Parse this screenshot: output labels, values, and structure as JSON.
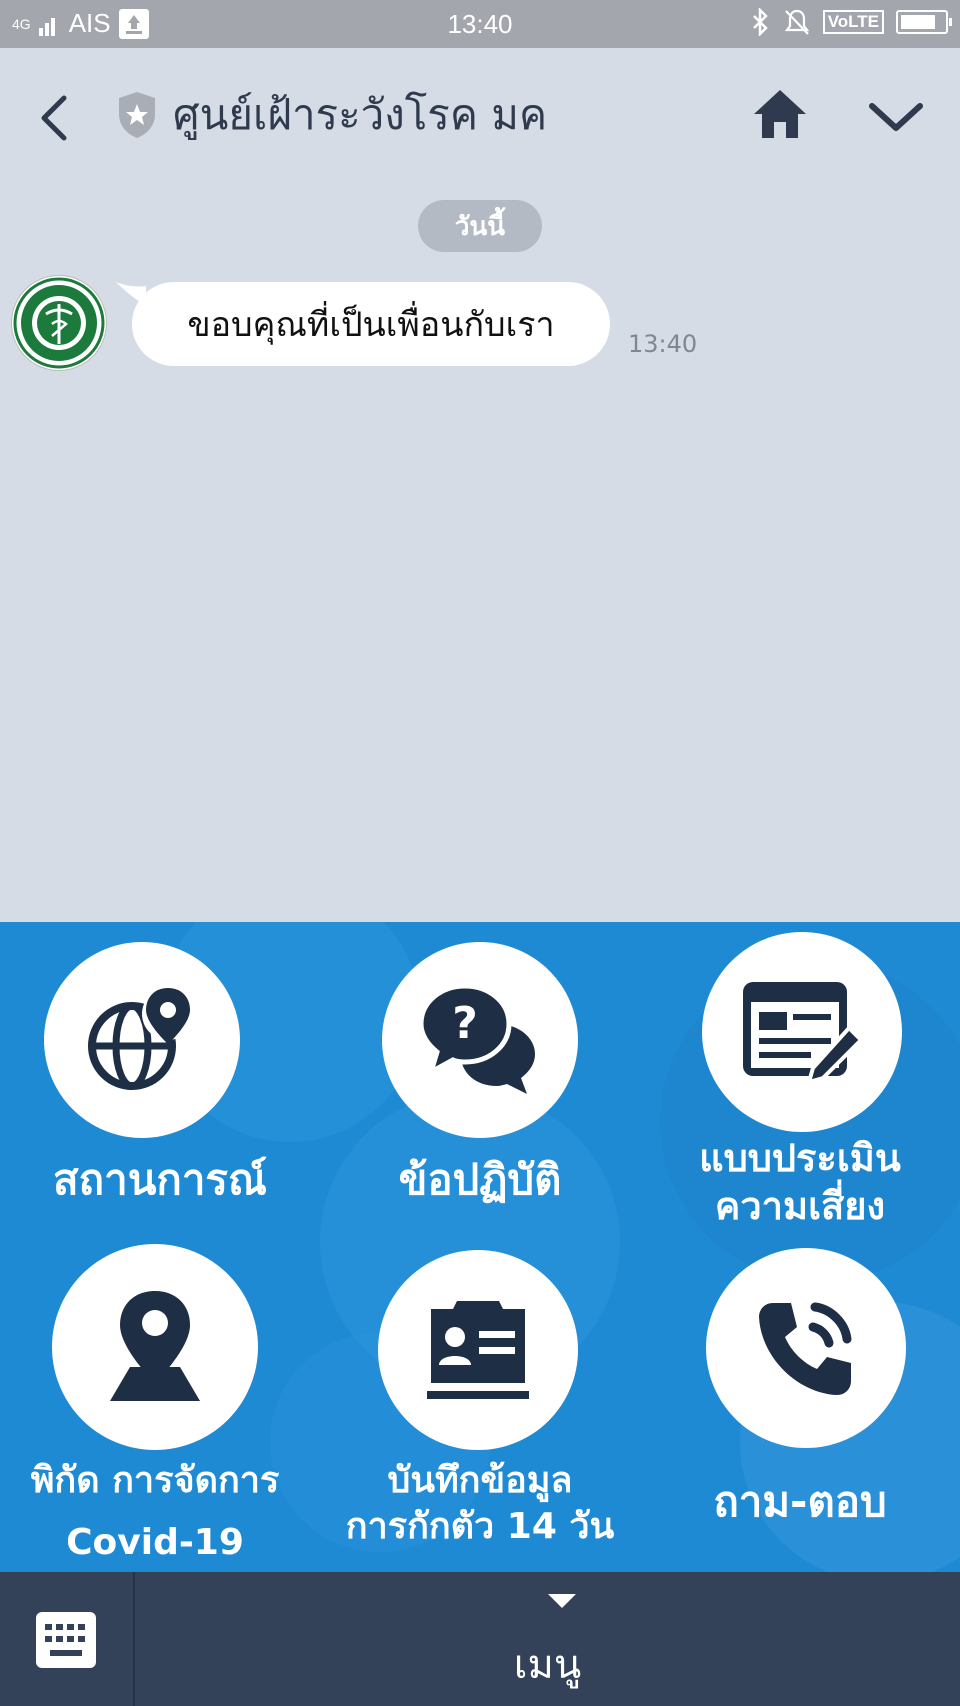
{
  "status_bar": {
    "network": "4G",
    "carrier": "AIS",
    "time": "13:40",
    "volte": "VoLTE",
    "battery_level": 0.9
  },
  "header": {
    "title": "ศูนย์เฝ้าระวังโรค มค"
  },
  "chat": {
    "date_label": "วันนี้",
    "messages": [
      {
        "text": "ขอบคุณที่เป็นเพื่อนกับเรา",
        "time": "13:40"
      }
    ]
  },
  "rich_menu": {
    "tiles": [
      {
        "label": "สถานการณ์",
        "icon": "globe-pin-icon"
      },
      {
        "label": "ข้อปฏิบัติ",
        "icon": "question-chat-icon"
      },
      {
        "label_line1": "แบบประเมิน",
        "label_line2": "ความเสี่ยง",
        "icon": "form-edit-icon"
      },
      {
        "label_line1": "พิกัด การจัดการ",
        "label_line2": "Covid-19",
        "icon": "map-pin-icon"
      },
      {
        "label_line1": "บันทึกข้อมูล",
        "label_line2": "การกักตัว 14 วัน",
        "icon": "id-card-icon"
      },
      {
        "label": "ถาม-ตอบ",
        "icon": "phone-call-icon"
      }
    ]
  },
  "bottom_bar": {
    "menu_label": "เมนู"
  },
  "colors": {
    "chat_bg": "#d6dce5",
    "rich_menu_bg": "#1f8ad4",
    "bottom_bar_bg": "#334159",
    "icon_dark": "#1e2e44"
  }
}
